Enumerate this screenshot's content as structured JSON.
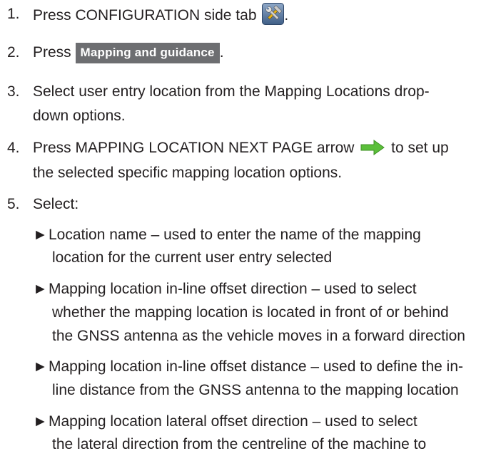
{
  "steps": [
    {
      "num": "1.",
      "text_before": "Press CONFIGURATION side tab",
      "text_after": "."
    },
    {
      "num": "2.",
      "text_before": "Press",
      "button_label": "Mapping and guidance",
      "text_after": "."
    },
    {
      "num": "3.",
      "line1": "Select user entry location from the Mapping Locations drop-",
      "line2": "down options."
    },
    {
      "num": "4.",
      "text_before": "Press MAPPING LOCATION NEXT PAGE arrow",
      "text_after": "to set up",
      "line2": "the selected specific mapping location options."
    },
    {
      "num": "5.",
      "text": "Select:"
    }
  ],
  "bullets": [
    {
      "line1": "Location name – used to enter the name of the mapping",
      "line2": "location for the current user entry selected"
    },
    {
      "line1": "Mapping location in-line offset direction – used to select",
      "line2": "whether the mapping location is located in front of or behind",
      "line3": "the GNSS antenna as the vehicle moves in a forward direction"
    },
    {
      "line1": "Mapping location in-line offset distance – used to define the in-",
      "line2": "line distance from the GNSS antenna to the mapping location"
    },
    {
      "line1": "Mapping location lateral offset direction – used to select",
      "line2": "the lateral direction from the centreline of the machine to"
    }
  ],
  "bullet_marker": "►",
  "icons": {
    "config_tab": "tools-icon",
    "next_page": "green-right-arrow-icon"
  },
  "colors": {
    "arrow": "#5bbf3a",
    "button_bg": "#6d6e71",
    "text": "#231f20"
  }
}
